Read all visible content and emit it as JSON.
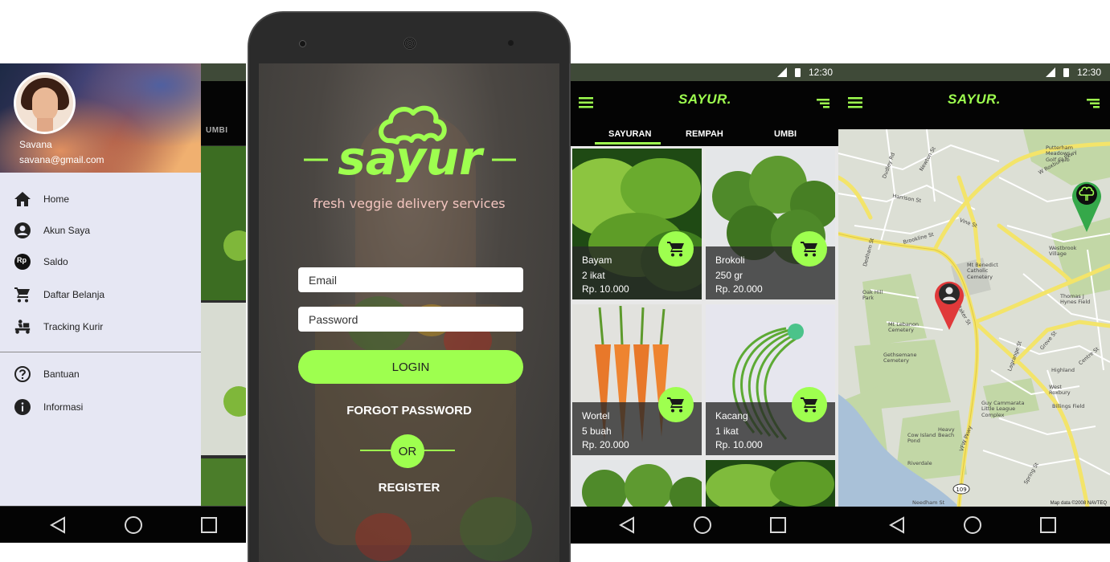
{
  "drawer": {
    "user_name": "Savana",
    "user_email": "savana@gmail.com",
    "items": [
      {
        "label": "Home",
        "icon": "home-icon"
      },
      {
        "label": "Akun Saya",
        "icon": "account-icon"
      },
      {
        "label": "Saldo",
        "icon": "balance-icon",
        "badge": "Rp"
      },
      {
        "label": "Daftar Belanja",
        "icon": "cart-icon"
      },
      {
        "label": "Tracking Kurir",
        "icon": "courier-icon"
      }
    ],
    "secondary_items": [
      {
        "label": "Bantuan",
        "icon": "help-icon"
      },
      {
        "label": "Informasi",
        "icon": "info-icon"
      }
    ],
    "underlying_tab": "UMBI"
  },
  "login": {
    "logo_text": "sayur",
    "tagline": "fresh veggie delivery services",
    "email_placeholder": "Email",
    "password_placeholder": "Password",
    "login_label": "LOGIN",
    "forgot_label": "FORGOT PASSWORD",
    "or_label": "OR",
    "register_label": "REGISTER"
  },
  "products_screen": {
    "status_time": "12:30",
    "brand": "SAYUR.",
    "tabs": [
      "SAYURAN",
      "REMPAH",
      "UMBI"
    ],
    "active_tab": "SAYURAN",
    "products": [
      {
        "name": "Bayam",
        "qty": "2 ikat",
        "price": "Rp. 10.000"
      },
      {
        "name": "Brokoli",
        "qty": "250 gr",
        "price": "Rp. 20.000"
      },
      {
        "name": "Wortel",
        "qty": "5 buah",
        "price": "Rp. 20.000"
      },
      {
        "name": "Kacang",
        "qty": "1 ikat",
        "price": "Rp. 10.000"
      }
    ]
  },
  "map_screen": {
    "status_time": "12:30",
    "brand": "SAYUR.",
    "labels": {
      "putterham": "Putterham\nMeadows\nGolf Club",
      "westbrook": "Westbrook\nVillage",
      "mt_benedict": "Mt Benedict\nCatholic\nCemetery",
      "oak_hill": "Oak Hill\nPark",
      "mt_lebanon": "Mt Lebanon\nCemetery",
      "thomas": "Thomas J\nHynes Field",
      "gethsemane": "Gethsemane\nCemetery",
      "highland": "Highland",
      "west_roxbury": "West\nRoxbury",
      "billings": "Billings Field",
      "guy": "Guy Cammarata\nLittle League\nComplex",
      "cow_island": "Cow Island\nPond",
      "heavy_beach": "Heavy\nBeach",
      "riverdale": "Riverdale",
      "copyright": "Map data ©2008 NAVTEQ"
    },
    "streets": [
      "Newton St",
      "W Roxbury Pkwy",
      "Brookline St",
      "Vine St",
      "Dudley Rd",
      "Harrison St",
      "Dedham St",
      "Baker St",
      "Lagrange St",
      "VFW Pkwy",
      "Centre St",
      "Grove St",
      "Spring St",
      "Needham St"
    ]
  },
  "colors": {
    "accent": "#9eff4f",
    "app_bar": "#040404",
    "status_bar": "#3f4a38",
    "drawer_bg": "#e6e7f3"
  }
}
